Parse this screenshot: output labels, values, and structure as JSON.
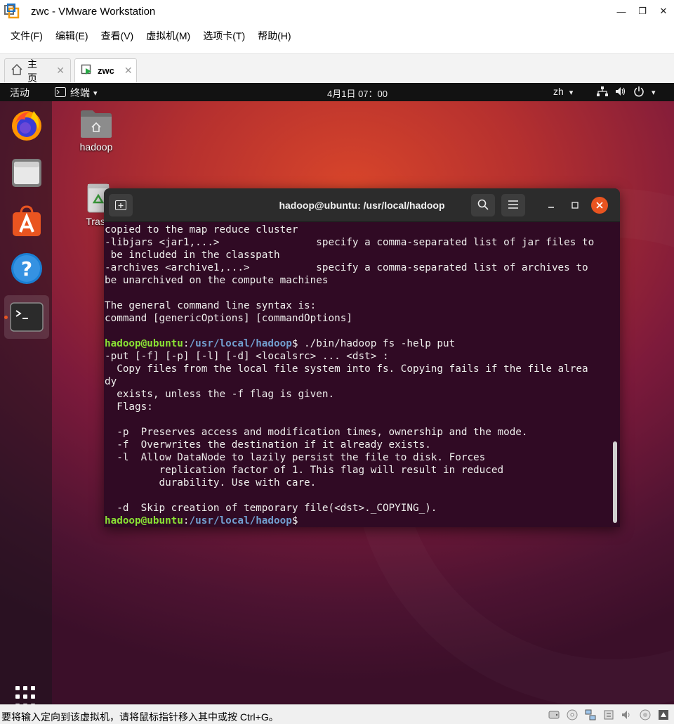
{
  "window": {
    "title": "zwc - VMware Workstation",
    "controls": {
      "minimize": "—",
      "maximize": "❐",
      "close": "✕"
    }
  },
  "menubar": {
    "items": [
      {
        "label": "文件(F)"
      },
      {
        "label": "编辑(E)"
      },
      {
        "label": "查看(V)"
      },
      {
        "label": "虚拟机(M)"
      },
      {
        "label": "选项卡(T)"
      },
      {
        "label": "帮助(H)"
      }
    ]
  },
  "tabs": [
    {
      "label": "主页",
      "icon": "home-icon",
      "active": false,
      "close": "✕"
    },
    {
      "label": "zwc",
      "icon": "vm-play-icon",
      "active": true,
      "close": "✕"
    }
  ],
  "gnome": {
    "activities": "活动",
    "app_menu": "终端",
    "clock": "4月1日  07：00",
    "language": "zh",
    "dropdown": "▾"
  },
  "desktop": {
    "icons": [
      {
        "label": "hadoop",
        "icon": "home-folder-icon"
      },
      {
        "label": "Trash",
        "icon": "trash-icon"
      }
    ]
  },
  "dock": {
    "items": [
      {
        "name": "firefox",
        "icon": "firefox-icon"
      },
      {
        "name": "files",
        "icon": "files-icon"
      },
      {
        "name": "software",
        "icon": "ubuntu-software-icon"
      },
      {
        "name": "help",
        "icon": "help-icon"
      },
      {
        "name": "terminal",
        "icon": "terminal-icon",
        "running": true
      }
    ],
    "show_apps_icon": "grid-icon"
  },
  "terminal": {
    "title": "hadoop@ubuntu: /usr/local/hadoop",
    "lines": [
      {
        "text": "copied to the map reduce cluster"
      },
      {
        "text": "-libjars <jar1,...>                specify a comma-separated list of jar files to"
      },
      {
        "text": " be included in the classpath"
      },
      {
        "text": "-archives <archive1,...>           specify a comma-separated list of archives to"
      },
      {
        "text": "be unarchived on the compute machines"
      },
      {
        "text": ""
      },
      {
        "text": "The general command line syntax is:"
      },
      {
        "text": "command [genericOptions] [commandOptions]"
      },
      {
        "text": ""
      },
      {
        "prompt_user": "hadoop@ubuntu",
        "prompt_sep": ":",
        "prompt_path": "/usr/local/hadoop",
        "prompt_end": "$",
        "text": " ./bin/hadoop fs -help put"
      },
      {
        "text": "-put [-f] [-p] [-l] [-d] <localsrc> ... <dst> :"
      },
      {
        "text": "  Copy files from the local file system into fs. Copying fails if the file alrea"
      },
      {
        "text": "dy"
      },
      {
        "text": "  exists, unless the -f flag is given."
      },
      {
        "text": "  Flags:"
      },
      {
        "text": ""
      },
      {
        "text": "  -p  Preserves access and modification times, ownership and the mode."
      },
      {
        "text": "  -f  Overwrites the destination if it already exists."
      },
      {
        "text": "  -l  Allow DataNode to lazily persist the file to disk. Forces"
      },
      {
        "text": "         replication factor of 1. This flag will result in reduced"
      },
      {
        "text": "         durability. Use with care."
      },
      {
        "text": ""
      },
      {
        "text": "  -d  Skip creation of temporary file(<dst>._COPYING_)."
      },
      {
        "prompt_user": "hadoop@ubuntu",
        "prompt_sep": ":",
        "prompt_path": "/usr/local/hadoop",
        "prompt_end": "$",
        "text": ""
      }
    ]
  },
  "statusbar": {
    "message": "要将输入定向到该虚拟机，请将鼠标指针移入其中或按 Ctrl+G。",
    "icons": [
      "hdd-icon",
      "cdrom-icon",
      "network-icon",
      "usb-icon",
      "sound-icon",
      "printer-icon",
      "vm-logo-icon"
    ]
  },
  "colors": {
    "terminal_bg": "#300a24",
    "prompt_user": "#8ae234",
    "prompt_path": "#729fcf",
    "ubuntu_orange": "#e95420"
  }
}
